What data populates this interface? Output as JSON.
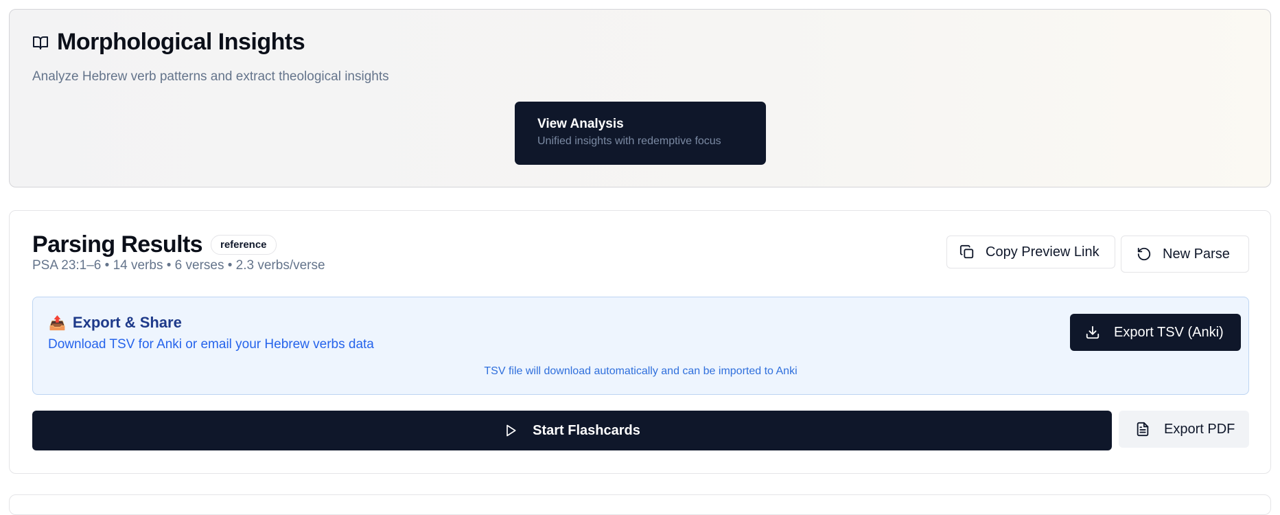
{
  "insights": {
    "title": "Morphological Insights",
    "subtitle": "Analyze Hebrew verb patterns and extract theological insights",
    "icon": "book-open-icon",
    "view_analysis": {
      "label": "View Analysis",
      "sublabel": "Unified insights with redemptive focus"
    }
  },
  "parsing": {
    "title": "Parsing Results",
    "badge": "reference",
    "meta": "PSA 23:1–6 • 14 verbs • 6 verses • 2.3 verbs/verse",
    "copy_link_label": "Copy Preview Link",
    "new_parse_label": "New Parse",
    "export_panel": {
      "emoji": "📤",
      "title": "Export & Share",
      "subtitle": "Download TSV for Anki or email your Hebrew verbs data",
      "hint": "TSV file will download automatically and can be imported to Anki",
      "export_tsv_label": "Export TSV (Anki)"
    },
    "start_flashcards_label": "Start Flashcards",
    "export_pdf_label": "Export PDF"
  },
  "colors": {
    "primary_dark": "#0f172a",
    "muted_text": "#64748b",
    "export_panel_bg": "#eef5fe",
    "export_title": "#1e3a8a",
    "export_link": "#2563eb"
  }
}
